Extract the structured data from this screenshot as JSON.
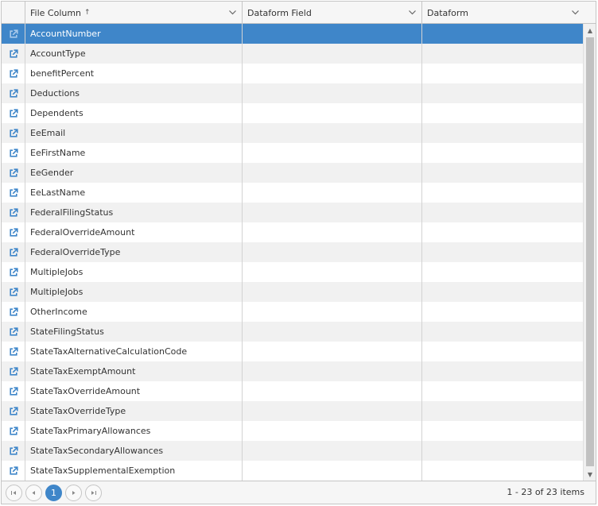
{
  "columns": {
    "file_column": "File Column",
    "dataform_field": "Dataform Field",
    "dataform": "Dataform",
    "sort_indicator": "↑"
  },
  "rows": [
    "AccountNumber",
    "AccountType",
    "benefitPercent",
    "Deductions",
    "Dependents",
    "EeEmail",
    "EeFirstName",
    "EeGender",
    "EeLastName",
    "FederalFilingStatus",
    "FederalOverrideAmount",
    "FederalOverrideType",
    "MultipleJobs",
    "MultipleJobs",
    "OtherIncome",
    "StateFilingStatus",
    "StateTaxAlternativeCalculationCode",
    "StateTaxExemptAmount",
    "StateTaxOverrideAmount",
    "StateTaxOverrideType",
    "StateTaxPrimaryAllowances",
    "StateTaxSecondaryAllowances",
    "StateTaxSupplementalExemption"
  ],
  "selected_row_index": 0,
  "pager": {
    "current_page": "1",
    "info": "1 - 23 of 23 items"
  },
  "colors": {
    "selected_row": "#3f86c9",
    "icon": "#3f86c9",
    "alt_row": "#f1f1f1"
  },
  "icons": {
    "row_action": "external-link-icon",
    "column_menu": "chevron-down-icon",
    "pager_first": "first-page-icon",
    "pager_prev": "previous-page-icon",
    "pager_next": "next-page-icon",
    "pager_last": "last-page-icon"
  }
}
